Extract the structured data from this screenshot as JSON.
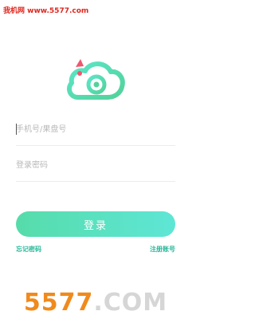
{
  "watermark_top": "我机网 www.5577.com",
  "login": {
    "account_placeholder": "手机号/果盘号",
    "password_placeholder": "登录密码",
    "submit_label": "登录",
    "forgot_label": "忘记密码",
    "register_label": "注册账号"
  },
  "watermark_bottom": {
    "number": "5577",
    "dot": ".",
    "domain": "COM"
  },
  "colors": {
    "accent_start": "#56dcaa",
    "accent_end": "#5ee6d6",
    "link": "#2bb89a",
    "watermark_red": "#e0261e",
    "watermark_orange": "#f08a1c"
  },
  "icons": {
    "logo": "cloud-at-icon"
  }
}
